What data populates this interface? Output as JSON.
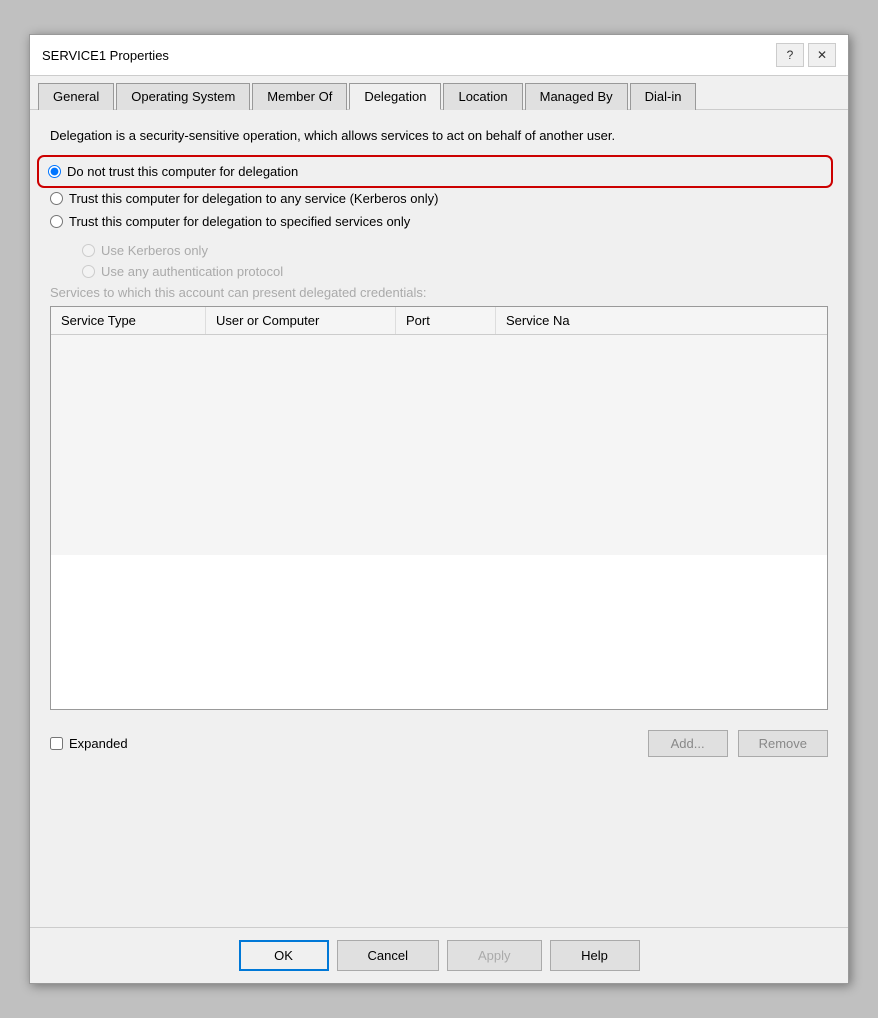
{
  "window": {
    "title": "SERVICE1 Properties",
    "help_btn": "?",
    "close_btn": "✕"
  },
  "tabs": [
    {
      "id": "general",
      "label": "General",
      "active": false
    },
    {
      "id": "os",
      "label": "Operating System",
      "active": false
    },
    {
      "id": "member-of",
      "label": "Member Of",
      "active": false
    },
    {
      "id": "delegation",
      "label": "Delegation",
      "active": true
    },
    {
      "id": "location",
      "label": "Location",
      "active": false
    },
    {
      "id": "managed-by",
      "label": "Managed By",
      "active": false
    },
    {
      "id": "dial-in",
      "label": "Dial-in",
      "active": false
    }
  ],
  "delegation": {
    "description": "Delegation is a security-sensitive operation, which allows services to act on behalf of another user.",
    "options": [
      {
        "id": "no-trust",
        "label": "Do not trust this computer for delegation",
        "selected": true,
        "highlighted": true
      },
      {
        "id": "trust-any",
        "label": "Trust this computer for delegation to any service (Kerberos only)",
        "selected": false,
        "highlighted": false
      },
      {
        "id": "trust-specified",
        "label": "Trust this computer for delegation to specified services only",
        "selected": false,
        "highlighted": false
      }
    ],
    "sub_options": [
      {
        "id": "kerberos-only",
        "label": "Use Kerberos only",
        "selected": false
      },
      {
        "id": "any-protocol",
        "label": "Use any authentication protocol",
        "selected": false
      }
    ],
    "services_label": "Services to which this account can present delegated credentials:",
    "table": {
      "columns": [
        {
          "id": "service-type",
          "label": "Service Type"
        },
        {
          "id": "user-computer",
          "label": "User or Computer"
        },
        {
          "id": "port",
          "label": "Port"
        },
        {
          "id": "service-name",
          "label": "Service Na"
        }
      ],
      "rows": []
    },
    "expanded_label": "Expanded",
    "add_btn": "Add...",
    "remove_btn": "Remove"
  },
  "footer": {
    "ok_label": "OK",
    "cancel_label": "Cancel",
    "apply_label": "Apply",
    "help_label": "Help"
  }
}
